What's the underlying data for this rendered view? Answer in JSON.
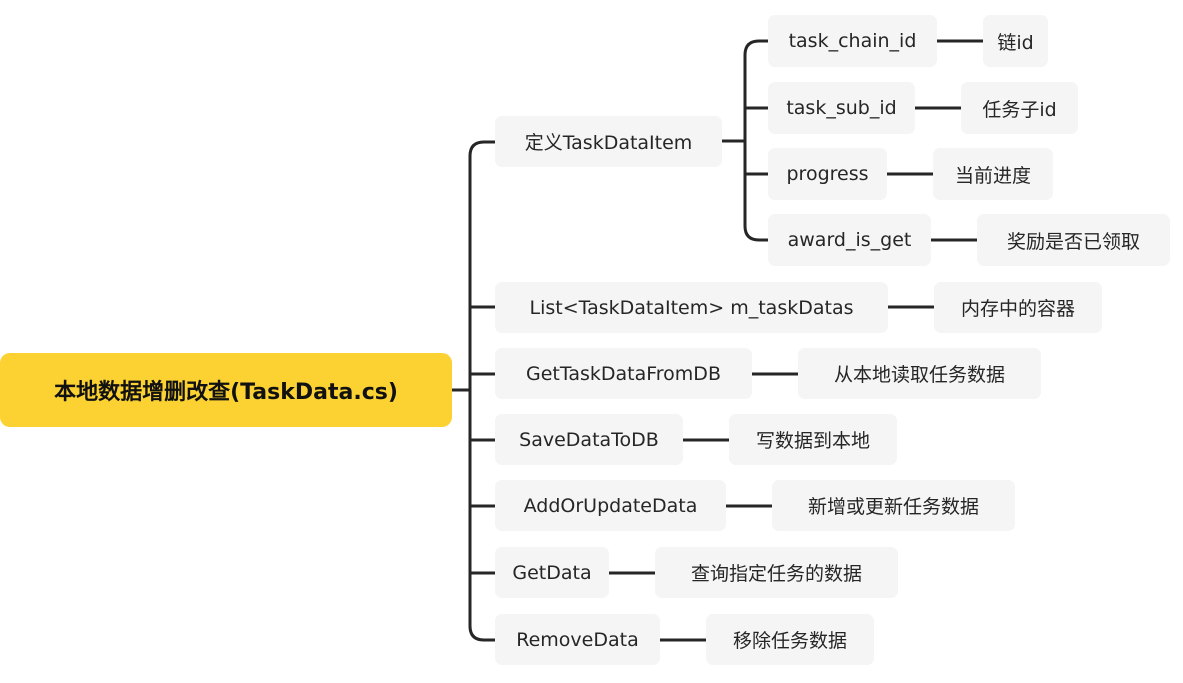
{
  "root": {
    "label": "本地数据增删改查(TaskData.cs)"
  },
  "branches": [
    {
      "label": "定义TaskDataItem",
      "children": [
        {
          "label": "task_chain_id",
          "note": "链id"
        },
        {
          "label": "task_sub_id",
          "note": "任务子id"
        },
        {
          "label": "progress",
          "note": "当前进度"
        },
        {
          "label": "award_is_get",
          "note": "奖励是否已领取"
        }
      ]
    },
    {
      "label": "List<TaskDataItem> m_taskDatas",
      "note": "内存中的容器"
    },
    {
      "label": "GetTaskDataFromDB",
      "note": "从本地读取任务数据"
    },
    {
      "label": "SaveDataToDB",
      "note": "写数据到本地"
    },
    {
      "label": "AddOrUpdateData",
      "note": "新增或更新任务数据"
    },
    {
      "label": "GetData",
      "note": "查询指定任务的数据"
    },
    {
      "label": "RemoveData",
      "note": "移除任务数据"
    }
  ],
  "colors": {
    "root_fill": "#fbd232",
    "node_fill": "#f5f5f5",
    "line": "#262626"
  }
}
